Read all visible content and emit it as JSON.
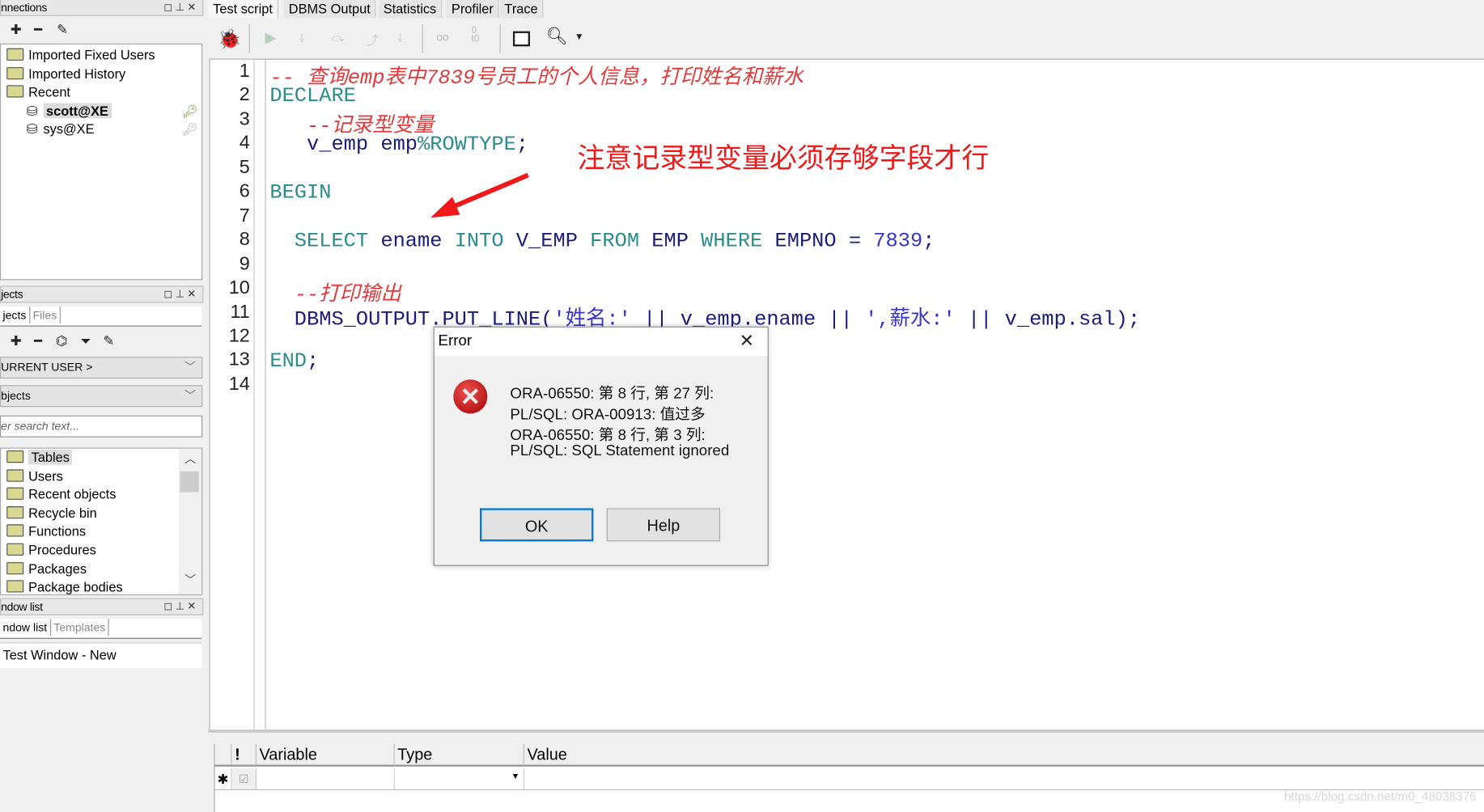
{
  "connections_panel": {
    "title": "nnections",
    "buttons": [
      "restore",
      "pin",
      "close"
    ],
    "tree": [
      {
        "label": "Imported Fixed Users",
        "icon": "folder-icon"
      },
      {
        "label": "Imported History",
        "icon": "folder-icon"
      },
      {
        "label": "Recent",
        "icon": "folder-icon"
      },
      {
        "label": "scott@XE",
        "icon": "database-icon",
        "selected": true,
        "status_icon": "key-check-icon"
      },
      {
        "label": "sys@XE",
        "icon": "database-icon",
        "status_icon": "key-icon"
      }
    ]
  },
  "objects_panel": {
    "title": "jects",
    "tabs": [
      "jects",
      "Files"
    ],
    "user_combo": "URRENT USER >",
    "type_combo": "bjects",
    "search_placeholder": "er search text...",
    "tree": [
      "Tables",
      "Users",
      "Recent objects",
      "Recycle bin",
      "Functions",
      "Procedures",
      "Packages",
      "Package bodies"
    ],
    "selected": "Tables"
  },
  "window_list_panel": {
    "title": "ndow list",
    "tabs": [
      "ndow list",
      "Templates"
    ],
    "items": [
      "Test Window - New"
    ]
  },
  "main_tabs": [
    "Test script",
    "DBMS Output",
    "Statistics",
    "Profiler",
    "Trace"
  ],
  "active_tab": "Test script",
  "code": [
    {
      "n": "1",
      "tokens": [
        {
          "t": "-- 查询emp表中7839号员工的个人信息，打印姓名和薪水",
          "c": "com"
        }
      ]
    },
    {
      "n": "2",
      "tokens": [
        {
          "t": "DECLARE",
          "c": "kw"
        }
      ]
    },
    {
      "n": "3",
      "tokens": [
        {
          "t": "   "
        },
        {
          "t": "--记录型变量",
          "c": "com"
        }
      ]
    },
    {
      "n": "4",
      "tokens": [
        {
          "t": "   "
        },
        {
          "t": "v_emp emp",
          "c": "id"
        },
        {
          "t": "%ROWTYPE",
          "c": "kw"
        },
        {
          "t": ";",
          "c": "id"
        }
      ]
    },
    {
      "n": "5",
      "tokens": []
    },
    {
      "n": "6",
      "tokens": [
        {
          "t": "BEGIN",
          "c": "kw"
        }
      ]
    },
    {
      "n": "7",
      "tokens": []
    },
    {
      "n": "8",
      "tokens": [
        {
          "t": "  "
        },
        {
          "t": "SELECT",
          "c": "kw"
        },
        {
          "t": " ename ",
          "c": "id"
        },
        {
          "t": "INTO",
          "c": "kw"
        },
        {
          "t": " V_EMP ",
          "c": "id"
        },
        {
          "t": "FROM",
          "c": "kw"
        },
        {
          "t": " EMP ",
          "c": "id"
        },
        {
          "t": "WHERE",
          "c": "kw"
        },
        {
          "t": " EMPNO = ",
          "c": "id"
        },
        {
          "t": "7839",
          "c": "num"
        },
        {
          "t": ";",
          "c": "id"
        }
      ]
    },
    {
      "n": "9",
      "tokens": []
    },
    {
      "n": "10",
      "tokens": [
        {
          "t": "  "
        },
        {
          "t": "--打印输出",
          "c": "com"
        }
      ]
    },
    {
      "n": "11",
      "tokens": [
        {
          "t": "  "
        },
        {
          "t": "DBMS_OUTPUT.PUT_LINE(",
          "c": "id"
        },
        {
          "t": "'姓名:'",
          "c": "str"
        },
        {
          "t": " || v_emp.ename || ",
          "c": "id"
        },
        {
          "t": "',薪水:'",
          "c": "str"
        },
        {
          "t": " || v_emp.sal);",
          "c": "id"
        }
      ]
    },
    {
      "n": "12",
      "tokens": []
    },
    {
      "n": "13",
      "tokens": [
        {
          "t": "END",
          "c": "kw"
        },
        {
          "t": ";",
          "c": "id"
        }
      ]
    },
    {
      "n": "14",
      "tokens": []
    }
  ],
  "annotation": "注意记录型变量必须存够字段才行",
  "annotation_color": "#f01818",
  "error_dialog": {
    "title": "Error",
    "icon": "error-icon",
    "messages": [
      "ORA-06550: 第 8 行, 第 27 列:",
      "PL/SQL: ORA-00913: 值过多",
      "ORA-06550: 第 8 行, 第 3 列:",
      "PL/SQL: SQL Statement ignored"
    ],
    "ok_label": "OK",
    "help_label": "Help"
  },
  "variables_grid": {
    "columns": [
      "Variable",
      "Type",
      "Value"
    ]
  },
  "watermark": "https://blog.csdn.net/m0_48038376"
}
